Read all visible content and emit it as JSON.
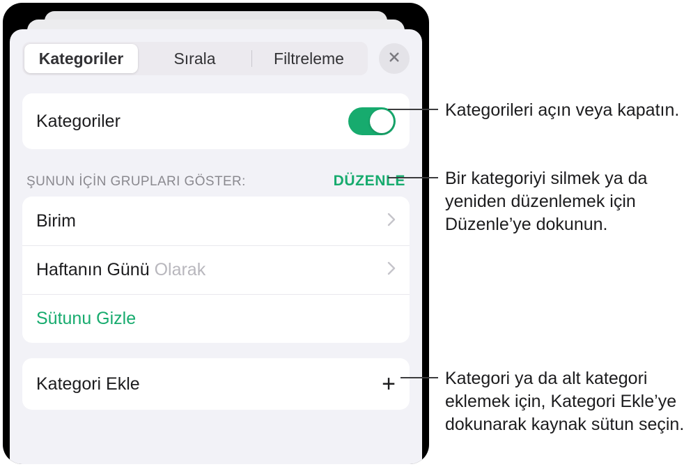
{
  "tabs": {
    "categories": "Kategoriler",
    "sort": "Sırala",
    "filter": "Filtreleme"
  },
  "close_name": "close",
  "categories_switch": {
    "label": "Kategoriler"
  },
  "groups_section": {
    "header": "ŞUNUN İÇİN GRUPLARI GÖSTER:",
    "edit": "DÜZENLE",
    "rows": [
      {
        "label": "Birim",
        "suffix": ""
      },
      {
        "label": "Haftanın Günü",
        "suffix": " Olarak"
      }
    ],
    "hide_column": "Sütunu Gizle"
  },
  "add_category": {
    "label": "Kategori Ekle"
  },
  "callouts": {
    "toggle": "Kategorileri açın veya kapatın.",
    "edit": "Bir kategoriyi silmek ya da yeniden düzenlemek için Düzenle’ye dokunun.",
    "add": "Kategori ya da alt kategori eklemek için, Kategori Ekle’ye dokunarak kaynak sütun seçin."
  }
}
